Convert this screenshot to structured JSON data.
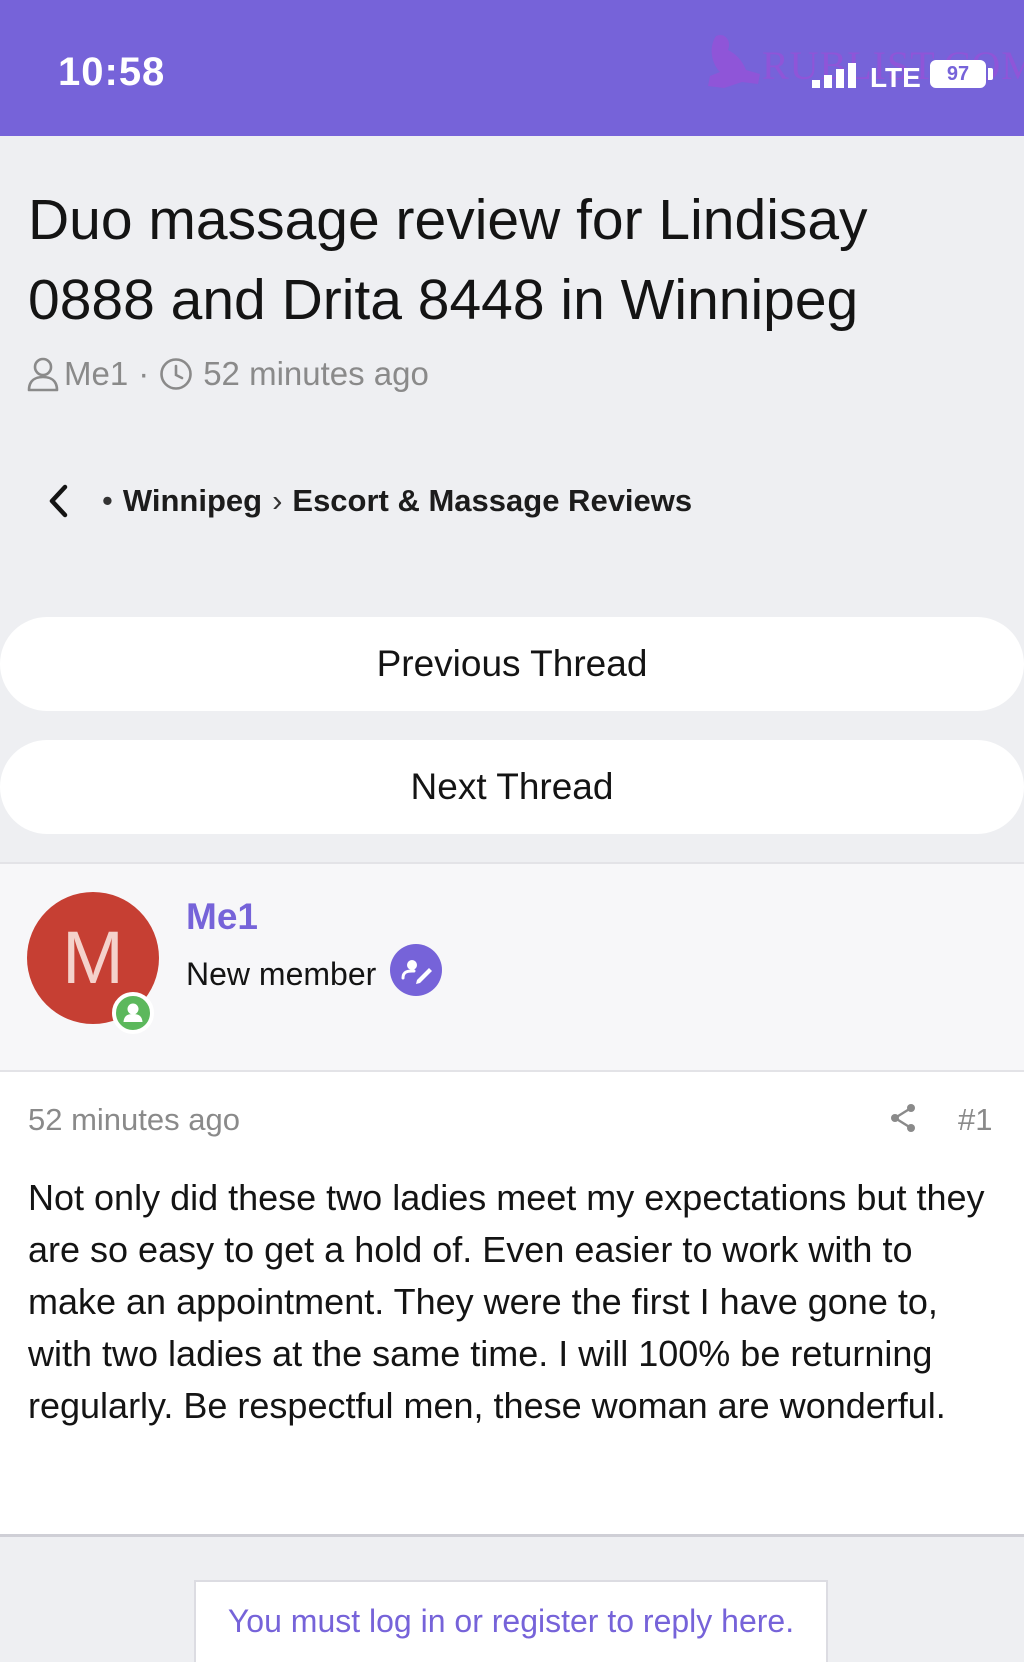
{
  "status_bar": {
    "time": "10:58",
    "network": "LTE",
    "battery": "97",
    "background_color": "#7663d9",
    "signal_icon": "signal-bars-icon",
    "battery_icon": "battery-icon"
  },
  "watermark": {
    "text": "RUBLIST.COM"
  },
  "thread": {
    "title": "Duo massage review for Lindisay 0888 and Drita 8448 in Winnipeg",
    "author": "Me1",
    "time_ago": "52 minutes ago",
    "author_icon": "user-icon",
    "time_icon": "clock-icon"
  },
  "breadcrumb": {
    "back_icon": "chevron-left-icon",
    "items": [
      "Winnipeg",
      "Escort & Massage Reviews"
    ]
  },
  "navigation": {
    "previous_label": "Previous Thread",
    "next_label": "Next Thread"
  },
  "author_card": {
    "avatar_letter": "M",
    "avatar_color": "#c63f33",
    "name": "Me1",
    "role": "New member",
    "online_icon": "user-online-icon",
    "role_icon": "pencil-icon"
  },
  "post": {
    "time_ago": "52 minutes ago",
    "number": "#1",
    "share_icon": "share-icon",
    "body": "Not only did these two ladies meet my expectations but they are so easy to get a hold of. Even easier to work with to make an appointment. They were the first I have gone to, with two ladies at the same time. I will 100% be returning regularly. Be respectful men, these woman are wonderful."
  },
  "reply": {
    "prompt": "You must log in or register to reply here."
  },
  "colors": {
    "accent": "#7663d9",
    "page_background": "#eeeff2",
    "muted_text": "#8a8a8a",
    "online_green": "#5cb85c"
  }
}
